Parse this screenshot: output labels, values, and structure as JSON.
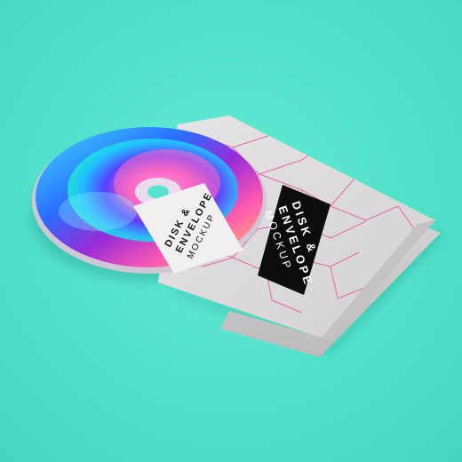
{
  "colors": {
    "background": "#57e3cd",
    "envelope": "#dedcdc",
    "envelope_flap": "#cfcdcd",
    "pattern": "#e0559a",
    "band": "#0d0d0d",
    "sticker": "#f1efef"
  },
  "envelope_label": {
    "line1": "DISK &",
    "line2": "ENVELOPE",
    "line3": "MOCKUP"
  },
  "disc_label": {
    "line1": "DISK &",
    "line2": "ENVELOPE",
    "line3": "MOCKUP"
  }
}
